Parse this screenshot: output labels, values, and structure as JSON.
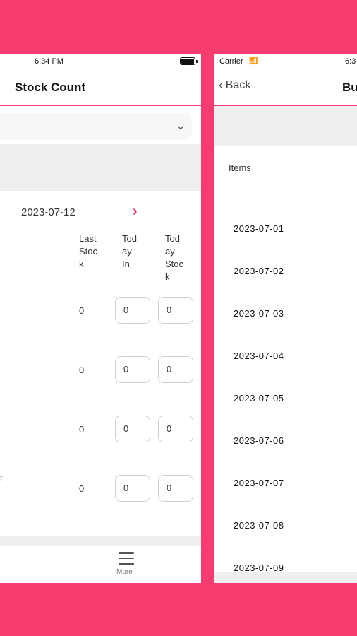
{
  "left_screen": {
    "status_time": "6:34 PM",
    "title": "Stock Count",
    "date": "2023-07-12",
    "next_icon": "chevron-right-icon",
    "columns": [
      "Last\nStoc\nk",
      "Tod\nay\nIn",
      "Tod\nay\nStoc\nk"
    ],
    "rows": [
      {
        "last_stock": "0",
        "today_in": "0",
        "today_stock": "0"
      },
      {
        "last_stock": "0",
        "today_in": "0",
        "today_stock": "0"
      },
      {
        "last_stock": "0",
        "today_in": "0",
        "today_stock": "0"
      },
      {
        "last_stock": "0",
        "today_in": "0",
        "today_stock": "0"
      }
    ],
    "row_label_fragment": "r",
    "tab_more_label": "More",
    "tab_more_icon": "hamburger-icon"
  },
  "right_screen": {
    "carrier": "Carrier",
    "status_time_partial": "6:3",
    "back_label": "Back",
    "title_partial": "Bu",
    "items_label": "Items",
    "dates": [
      "2023-07-01",
      "2023-07-02",
      "2023-07-03",
      "2023-07-04",
      "2023-07-05",
      "2023-07-06",
      "2023-07-07",
      "2023-07-08",
      "2023-07-09"
    ]
  },
  "colors": {
    "accent": "#f73d6f",
    "arrow": "#e8245b"
  }
}
